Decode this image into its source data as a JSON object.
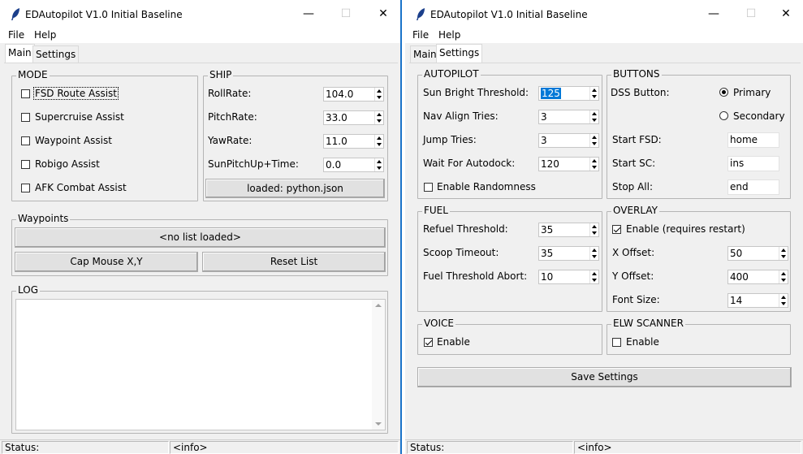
{
  "left_window": {
    "title": "EDAutopilot V1.0 Initial Baseline",
    "controls": {
      "minimize": "—",
      "maximize": "☐",
      "close": "✕"
    },
    "menu": [
      "File",
      "Help"
    ],
    "tabs": [
      "Main",
      "Settings"
    ],
    "active_tab": "Main",
    "mode": {
      "legend": "MODE",
      "items": [
        {
          "label": "FSD Route Assist",
          "checked": false,
          "focused": true
        },
        {
          "label": "Supercruise Assist",
          "checked": false
        },
        {
          "label": "Waypoint Assist",
          "checked": false
        },
        {
          "label": "Robigo Assist",
          "checked": false
        },
        {
          "label": "AFK Combat Assist",
          "checked": false
        }
      ]
    },
    "ship": {
      "legend": "SHIP",
      "fields": [
        {
          "label": "RollRate:",
          "value": "104.0"
        },
        {
          "label": "PitchRate:",
          "value": "33.0"
        },
        {
          "label": "YawRate:",
          "value": "11.0"
        },
        {
          "label": "SunPitchUp+Time:",
          "value": "0.0"
        }
      ],
      "button": "loaded: python.json"
    },
    "waypoints": {
      "legend": "Waypoints",
      "list_button": "<no list loaded>",
      "cap_button": "Cap Mouse X,Y",
      "reset_button": "Reset List"
    },
    "log": {
      "legend": "LOG",
      "text": ""
    },
    "status": {
      "label": "Status:",
      "info": "<info>"
    }
  },
  "right_window": {
    "title": "EDAutopilot V1.0 Initial Baseline",
    "controls": {
      "minimize": "—",
      "maximize": "☐",
      "close": "✕"
    },
    "menu": [
      "File",
      "Help"
    ],
    "tabs": [
      "Main",
      "Settings"
    ],
    "active_tab": "Settings",
    "autopilot": {
      "legend": "AUTOPILOT",
      "fields": [
        {
          "label": "Sun Bright Threshold:",
          "value": "125",
          "selected": true
        },
        {
          "label": "Nav Align Tries:",
          "value": "3"
        },
        {
          "label": "Jump Tries:",
          "value": "3"
        },
        {
          "label": "Wait For Autodock:",
          "value": "120"
        }
      ],
      "randomness": {
        "label": "Enable Randomness",
        "checked": false
      }
    },
    "buttons": {
      "legend": "BUTTONS",
      "dss_label": "DSS Button:",
      "options": [
        {
          "label": "Primary",
          "selected": true
        },
        {
          "label": "Secondary",
          "selected": false
        }
      ],
      "fields": [
        {
          "label": "Start FSD:",
          "value": "home"
        },
        {
          "label": "Start SC:",
          "value": "ins"
        },
        {
          "label": "Stop All:",
          "value": "end"
        }
      ]
    },
    "fuel": {
      "legend": "FUEL",
      "fields": [
        {
          "label": "Refuel Threshold:",
          "value": "35"
        },
        {
          "label": "Scoop Timeout:",
          "value": "35"
        },
        {
          "label": "Fuel Threshold Abort:",
          "value": "10"
        }
      ]
    },
    "overlay": {
      "legend": "OVERLAY",
      "enable": {
        "label": "Enable (requires restart)",
        "checked": true
      },
      "fields": [
        {
          "label": "X Offset:",
          "value": "50"
        },
        {
          "label": "Y Offset:",
          "value": "400"
        },
        {
          "label": "Font Size:",
          "value": "14"
        }
      ]
    },
    "voice": {
      "legend": "VOICE",
      "enable": {
        "label": "Enable",
        "checked": true
      }
    },
    "elw_scanner": {
      "legend": "ELW SCANNER",
      "enable": {
        "label": "Enable",
        "checked": false
      }
    },
    "save_button": "Save Settings",
    "status": {
      "label": "Status:",
      "info": "<info>"
    }
  }
}
